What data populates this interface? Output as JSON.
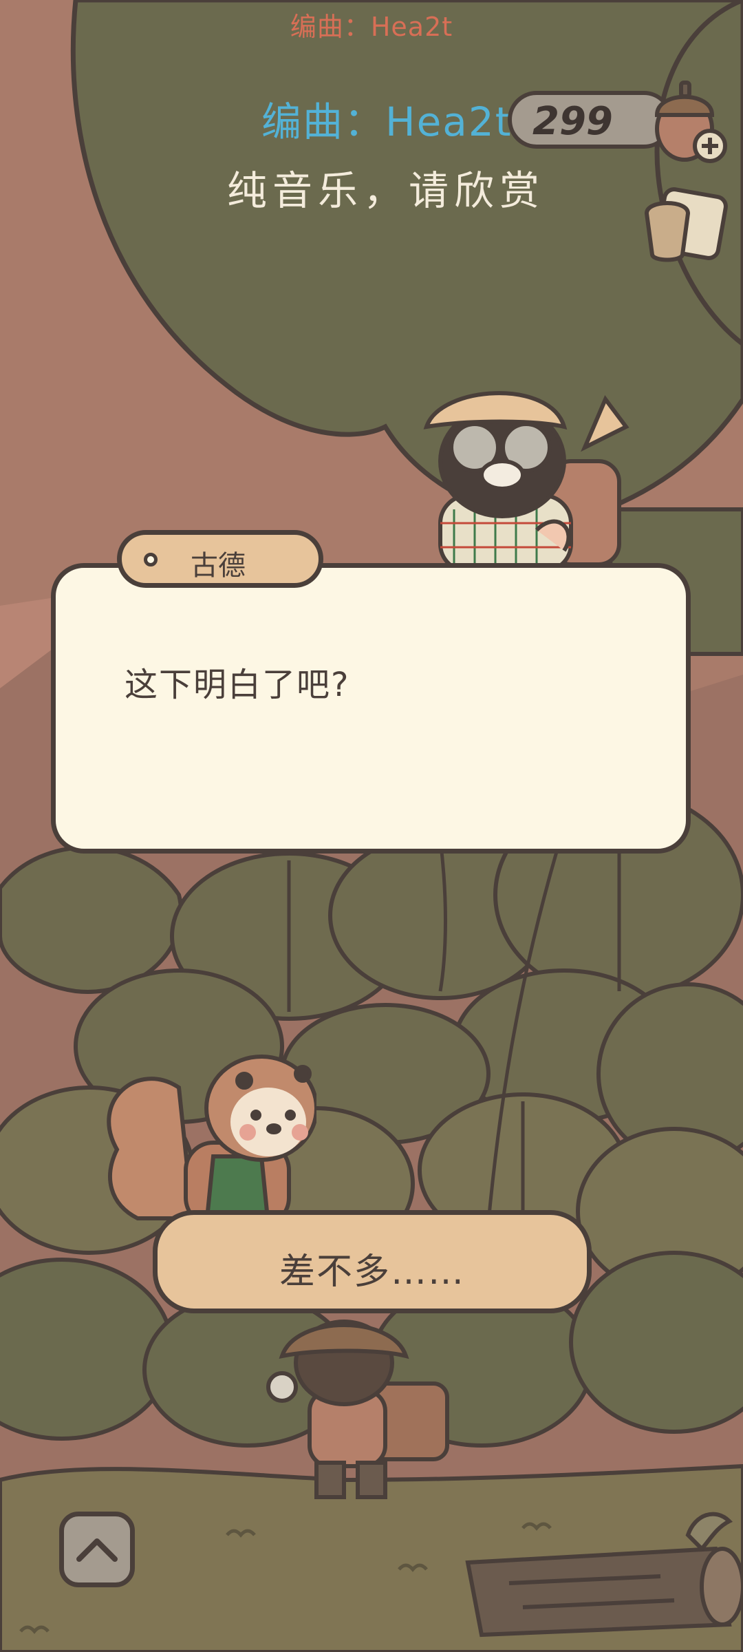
{
  "overlay": {
    "credit_top": "编曲：Hea2t",
    "credit_main": "编曲：Hea2t",
    "subtitle": "纯音乐，请欣赏"
  },
  "hud": {
    "currency_value": "299",
    "currency_icon": "acorn-icon",
    "plus_icon": "plus-icon",
    "secondary_icon": "cup-icon"
  },
  "dialog": {
    "speaker": "古德",
    "text": "这下明白了吧?"
  },
  "choices": [
    {
      "label": "差不多……"
    }
  ],
  "controls": {
    "expand_icon": "chevron-up-icon"
  },
  "colors": {
    "background": "#a97b6a",
    "foliage": "#6b6a4e",
    "outline": "#4a3f3a",
    "dialog_fill": "#fdf7e4",
    "tag_fill": "#e7c49b",
    "credit_blue": "#53b2d6",
    "credit_red": "#d86f56"
  }
}
